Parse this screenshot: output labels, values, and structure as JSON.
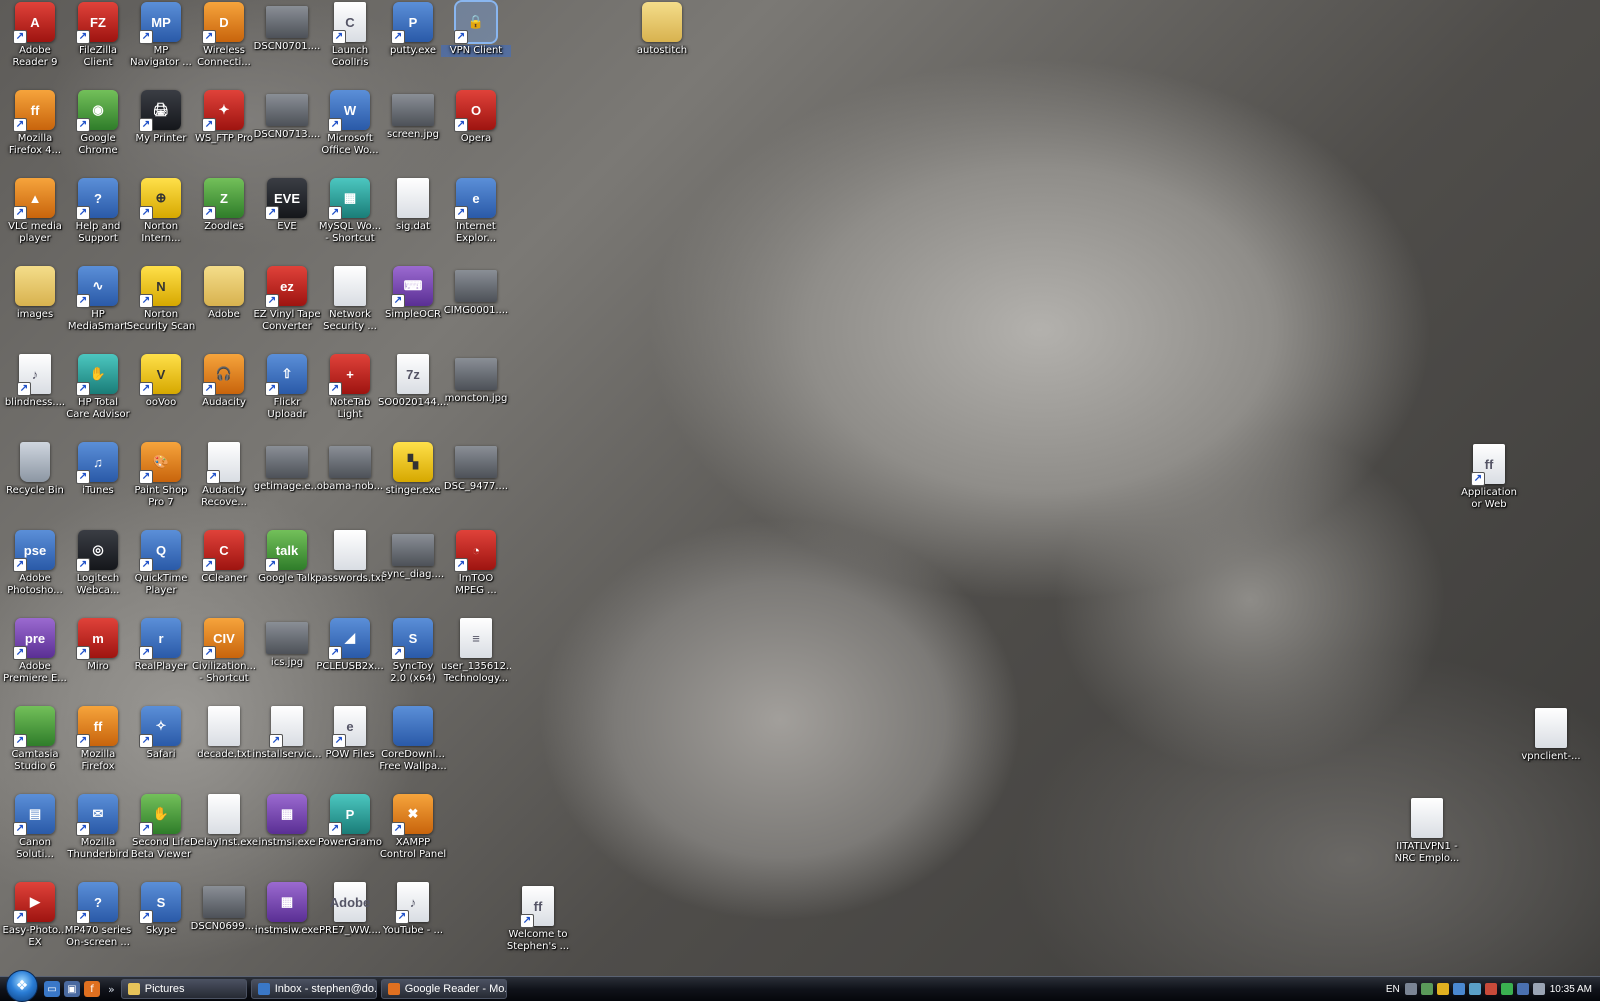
{
  "desktop": {
    "icons": [
      {
        "label": "Adobe\nReader 9",
        "glyph": "A",
        "style": "red",
        "shortcut": true,
        "icon": "adobe-reader-icon"
      },
      {
        "label": "FileZilla\nClient",
        "glyph": "FZ",
        "style": "red",
        "shortcut": true,
        "icon": "filezilla-icon"
      },
      {
        "label": "MP\nNavigator ...",
        "glyph": "MP",
        "style": "app",
        "shortcut": true,
        "icon": "mp-navigator-icon"
      },
      {
        "label": "Wireless\nConnecti...",
        "glyph": "D",
        "style": "orange",
        "shortcut": true,
        "icon": "dlink-wireless-icon"
      },
      {
        "label": "DSCN0701....",
        "glyph": "",
        "style": "photo",
        "shortcut": false,
        "icon": "photo-icon"
      },
      {
        "label": "Launch\nCoolIris",
        "glyph": "C",
        "style": "file",
        "shortcut": true,
        "icon": "cooliris-icon"
      },
      {
        "label": "putty.exe",
        "glyph": "P",
        "style": "app",
        "shortcut": true,
        "icon": "putty-icon"
      },
      {
        "label": "VPN Client",
        "glyph": "🔒",
        "style": "yellow",
        "shortcut": true,
        "icon": "vpn-lock-icon",
        "selected": true
      },
      {
        "label": "autostitch",
        "glyph": "",
        "style": "folder",
        "shortcut": false,
        "icon": "folder-icon"
      },
      {
        "label": "Mozilla\nFirefox 4...",
        "glyph": "ff",
        "style": "orange",
        "shortcut": true,
        "icon": "firefox-icon"
      },
      {
        "label": "Google\nChrome",
        "glyph": "◉",
        "style": "green",
        "shortcut": true,
        "icon": "chrome-icon"
      },
      {
        "label": "My Printer",
        "glyph": "🖨",
        "style": "dark",
        "shortcut": true,
        "icon": "printer-icon"
      },
      {
        "label": "WS_FTP Pro",
        "glyph": "✦",
        "style": "red",
        "shortcut": true,
        "icon": "wsftp-icon"
      },
      {
        "label": "DSCN0713....",
        "glyph": "",
        "style": "photo",
        "shortcut": false,
        "icon": "photo-icon"
      },
      {
        "label": "Microsoft\nOffice Wo...",
        "glyph": "W",
        "style": "app",
        "shortcut": true,
        "icon": "word-icon"
      },
      {
        "label": "screen.jpg",
        "glyph": "",
        "style": "photo",
        "shortcut": false,
        "icon": "image-file-icon"
      },
      {
        "label": "Opera",
        "glyph": "O",
        "style": "red",
        "shortcut": true,
        "icon": "opera-icon"
      },
      {
        "label": "VLC media\nplayer",
        "glyph": "▲",
        "style": "orange",
        "shortcut": true,
        "icon": "vlc-cone-icon"
      },
      {
        "label": "Help and\nSupport",
        "glyph": "?",
        "style": "app",
        "shortcut": true,
        "icon": "help-icon"
      },
      {
        "label": "Norton\nIntern...",
        "glyph": "⊕",
        "style": "yellow",
        "shortcut": true,
        "icon": "norton-globe-icon"
      },
      {
        "label": "Zoodles",
        "glyph": "Z",
        "style": "green",
        "shortcut": true,
        "icon": "zoodles-icon"
      },
      {
        "label": "EVE",
        "glyph": "EVE",
        "style": "dark",
        "shortcut": true,
        "icon": "eve-icon"
      },
      {
        "label": "MySQL Wo...\n- Shortcut",
        "glyph": "▦",
        "style": "teal",
        "shortcut": true,
        "icon": "mysql-icon"
      },
      {
        "label": "sig.dat",
        "glyph": "",
        "style": "file",
        "shortcut": false,
        "icon": "file-icon"
      },
      {
        "label": "Internet\nExplor...",
        "glyph": "e",
        "style": "app",
        "shortcut": true,
        "icon": "ie-icon"
      },
      {
        "label": "images",
        "glyph": "",
        "style": "folder",
        "shortcut": false,
        "icon": "folder-icon"
      },
      {
        "label": "HP\nMediaSmart",
        "glyph": "∿",
        "style": "app",
        "shortcut": true,
        "icon": "hp-mediasmart-icon"
      },
      {
        "label": "Norton\nSecurity Scan",
        "glyph": "N",
        "style": "yellow",
        "shortcut": true,
        "icon": "norton-scan-icon"
      },
      {
        "label": "Adobe",
        "glyph": "",
        "style": "folder",
        "shortcut": false,
        "icon": "folder-icon"
      },
      {
        "label": "EZ Vinyl Tape\nConverter",
        "glyph": "ez",
        "style": "red",
        "shortcut": true,
        "icon": "ez-vinyl-icon"
      },
      {
        "label": "Network\nSecurity ...",
        "glyph": "",
        "style": "file",
        "shortcut": false,
        "icon": "file-icon"
      },
      {
        "label": "SimpleOCR",
        "glyph": "⌨",
        "style": "purple",
        "shortcut": true,
        "icon": "simpleocr-icon"
      },
      {
        "label": "CIMG0001....",
        "glyph": "",
        "style": "photo",
        "shortcut": false,
        "icon": "photo-icon"
      },
      {
        "label": "blindness....",
        "glyph": "♪",
        "style": "file",
        "shortcut": true,
        "icon": "audio-file-icon"
      },
      {
        "label": "HP Total\nCare Advisor",
        "glyph": "✋",
        "style": "teal",
        "shortcut": true,
        "icon": "hp-care-icon"
      },
      {
        "label": "ooVoo",
        "glyph": "V",
        "style": "yellow",
        "shortcut": true,
        "icon": "oovoo-icon"
      },
      {
        "label": "Audacity",
        "glyph": "🎧",
        "style": "orange",
        "shortcut": true,
        "icon": "audacity-icon"
      },
      {
        "label": "Flickr\nUploadr",
        "glyph": "⇧",
        "style": "app",
        "shortcut": true,
        "icon": "flickr-icon"
      },
      {
        "label": "NoteTab\nLight",
        "glyph": "+",
        "style": "red",
        "shortcut": true,
        "icon": "notetab-icon"
      },
      {
        "label": "SO0020144....",
        "glyph": "7z",
        "style": "file",
        "shortcut": false,
        "icon": "archive-icon"
      },
      {
        "label": "moncton.jpg",
        "glyph": "",
        "style": "photo",
        "shortcut": false,
        "icon": "image-file-icon"
      },
      {
        "label": "Recycle Bin",
        "glyph": "",
        "style": "bin",
        "shortcut": false,
        "icon": "recycle-bin-icon"
      },
      {
        "label": "iTunes",
        "glyph": "♫",
        "style": "app",
        "shortcut": true,
        "icon": "itunes-icon"
      },
      {
        "label": "Paint Shop\nPro 7",
        "glyph": "🎨",
        "style": "orange",
        "shortcut": true,
        "icon": "paintshop-icon"
      },
      {
        "label": "Audacity\nRecove...",
        "glyph": "",
        "style": "file",
        "shortcut": true,
        "icon": "file-icon"
      },
      {
        "label": "getimage.e...",
        "glyph": "",
        "style": "photo",
        "shortcut": false,
        "icon": "image-file-icon"
      },
      {
        "label": "obama-nob...",
        "glyph": "",
        "style": "photo",
        "shortcut": false,
        "icon": "image-file-icon"
      },
      {
        "label": "stinger.exe",
        "glyph": "▚",
        "style": "yellow",
        "shortcut": false,
        "icon": "stinger-icon"
      },
      {
        "label": "DSC_9477....",
        "glyph": "",
        "style": "photo",
        "shortcut": false,
        "icon": "photo-icon"
      },
      {
        "label": "Adobe\nPhotosho...",
        "glyph": "pse",
        "style": "app",
        "shortcut": true,
        "icon": "photoshop-elements-icon"
      },
      {
        "label": "Logitech\nWebca...",
        "glyph": "◎",
        "style": "dark",
        "shortcut": true,
        "icon": "webcam-icon"
      },
      {
        "label": "QuickTime\nPlayer",
        "glyph": "Q",
        "style": "app",
        "shortcut": true,
        "icon": "quicktime-icon"
      },
      {
        "label": "CCleaner",
        "glyph": "C",
        "style": "red",
        "shortcut": true,
        "icon": "ccleaner-icon"
      },
      {
        "label": "Google Talk",
        "glyph": "talk",
        "style": "green",
        "shortcut": true,
        "icon": "google-talk-icon"
      },
      {
        "label": "passwords.txt",
        "glyph": "",
        "style": "file",
        "shortcut": false,
        "icon": "text-file-icon"
      },
      {
        "label": "sync_diag....",
        "glyph": "",
        "style": "photo",
        "shortcut": false,
        "icon": "image-file-icon"
      },
      {
        "label": "ImTOO\nMPEG ...",
        "glyph": "◔",
        "style": "red",
        "shortcut": true,
        "icon": "imtoo-icon"
      },
      {
        "label": "Adobe\nPremiere E...",
        "glyph": "pre",
        "style": "purple",
        "shortcut": true,
        "icon": "premiere-icon"
      },
      {
        "label": "Miro",
        "glyph": "m",
        "style": "red",
        "shortcut": true,
        "icon": "miro-icon"
      },
      {
        "label": "RealPlayer",
        "glyph": "r",
        "style": "app",
        "shortcut": true,
        "icon": "realplayer-icon"
      },
      {
        "label": "Civilization...\n- Shortcut",
        "glyph": "CIV",
        "style": "orange",
        "shortcut": true,
        "icon": "civilization-icon"
      },
      {
        "label": "ics.jpg",
        "glyph": "",
        "style": "photo",
        "shortcut": false,
        "icon": "image-file-icon"
      },
      {
        "label": "PCLEUSB2x...",
        "glyph": "◢",
        "style": "app",
        "shortcut": true,
        "icon": "pcle-icon"
      },
      {
        "label": "SyncToy\n2.0 (x64)",
        "glyph": "S",
        "style": "app",
        "shortcut": true,
        "icon": "synctoy-icon"
      },
      {
        "label": "user_135612...\nTechnology...",
        "glyph": "≡",
        "style": "file",
        "shortcut": false,
        "icon": "document-icon"
      },
      {
        "label": "Camtasia\nStudio 6",
        "glyph": "",
        "style": "green",
        "shortcut": true,
        "icon": "camtasia-icon"
      },
      {
        "label": "Mozilla\nFirefox",
        "glyph": "ff",
        "style": "orange",
        "shortcut": true,
        "icon": "firefox-icon"
      },
      {
        "label": "Safari",
        "glyph": "✧",
        "style": "app",
        "shortcut": true,
        "icon": "safari-compass-icon"
      },
      {
        "label": "decade.txt",
        "glyph": "",
        "style": "file",
        "shortcut": false,
        "icon": "text-file-icon"
      },
      {
        "label": "installservic...",
        "glyph": "",
        "style": "file",
        "shortcut": true,
        "icon": "file-icon"
      },
      {
        "label": "POW Files",
        "glyph": "e",
        "style": "file",
        "shortcut": true,
        "icon": "ie-file-icon"
      },
      {
        "label": "CoreDownl...\nFree Wallpa...",
        "glyph": "",
        "style": "app",
        "shortcut": false,
        "icon": "wallpaper-icon"
      },
      {
        "label": "Canon\nSoluti...",
        "glyph": "▤",
        "style": "app",
        "shortcut": true,
        "icon": "canon-icon"
      },
      {
        "label": "Mozilla\nThunderbird",
        "glyph": "✉",
        "style": "app",
        "shortcut": true,
        "icon": "thunderbird-icon"
      },
      {
        "label": "Second Life\nBeta Viewer",
        "glyph": "✋",
        "style": "green",
        "shortcut": true,
        "icon": "second-life-icon"
      },
      {
        "label": "DelayInst.exe",
        "glyph": "",
        "style": "file",
        "shortcut": false,
        "icon": "exe-icon"
      },
      {
        "label": "instmsi.exe",
        "glyph": "▦",
        "style": "purple",
        "shortcut": false,
        "icon": "installer-icon"
      },
      {
        "label": "PowerGramo",
        "glyph": "P",
        "style": "teal",
        "shortcut": true,
        "icon": "powergramo-icon"
      },
      {
        "label": "XAMPP\nControl Panel",
        "glyph": "✖",
        "style": "orange",
        "shortcut": true,
        "icon": "xampp-icon"
      },
      {
        "label": "Easy-Photo...\nEX",
        "glyph": "▶",
        "style": "red",
        "shortcut": true,
        "icon": "easy-photo-icon"
      },
      {
        "label": "MP470 series\nOn-screen ...",
        "glyph": "?",
        "style": "app",
        "shortcut": true,
        "icon": "mp470-help-icon"
      },
      {
        "label": "Skype",
        "glyph": "S",
        "style": "app",
        "shortcut": true,
        "icon": "skype-icon"
      },
      {
        "label": "DSCN0699....",
        "glyph": "",
        "style": "photo",
        "shortcut": false,
        "icon": "photo-icon"
      },
      {
        "label": "instmsiw.exe",
        "glyph": "▦",
        "style": "purple",
        "shortcut": false,
        "icon": "installer-icon"
      },
      {
        "label": "PRE7_WW....",
        "glyph": "Adobe",
        "style": "file",
        "shortcut": false,
        "icon": "adobe-package-icon"
      },
      {
        "label": "YouTube - ...",
        "glyph": "♪",
        "style": "file",
        "shortcut": true,
        "icon": "media-file-icon"
      },
      {
        "label": "Welcome to\nStephen's ...",
        "glyph": "ff",
        "style": "file",
        "shortcut": true,
        "icon": "firefox-doc-icon"
      },
      {
        "label": "Application\nor Web",
        "glyph": "ff",
        "style": "file",
        "shortcut": true,
        "icon": "firefox-doc-icon"
      },
      {
        "label": "vpnclient-...",
        "glyph": "",
        "style": "file",
        "shortcut": false,
        "icon": "vpn-file-icon"
      },
      {
        "label": "IITATLVPN1 -\nNRC Emplo...",
        "glyph": "",
        "style": "file",
        "shortcut": false,
        "icon": "file-icon"
      }
    ]
  },
  "taskbar": {
    "start_icon": "windows-orb-icon",
    "quick_launch": [
      {
        "icon": "show-desktop-icon",
        "color": "#3a78c8",
        "glyph": "▭"
      },
      {
        "icon": "switch-windows-icon",
        "color": "#4a6aa0",
        "glyph": "▣"
      },
      {
        "icon": "firefox-icon",
        "color": "#e07020",
        "glyph": "f"
      }
    ],
    "chevron": "»",
    "tasks": [
      {
        "label": "Pictures",
        "color": "#e6c35a",
        "icon": "folder-icon"
      },
      {
        "label": "Inbox - stephen@do...",
        "color": "#3a78c8",
        "icon": "thunderbird-icon"
      },
      {
        "label": "Google Reader - Mo...",
        "color": "#e07020",
        "icon": "firefox-icon"
      }
    ],
    "tray": {
      "language": "EN",
      "clock": "10:35 AM",
      "icons": [
        {
          "icon": "keyboard-icon",
          "color": "#7a8494"
        },
        {
          "icon": "mail-icon",
          "color": "#5a9a5a"
        },
        {
          "icon": "norton-tray-icon",
          "color": "#e0b020"
        },
        {
          "icon": "network-tray-icon",
          "color": "#4a88d0"
        },
        {
          "icon": "update-tray-icon",
          "color": "#5aa0c8"
        },
        {
          "icon": "security-tray-icon",
          "color": "#c84a3a"
        },
        {
          "icon": "signal-bars-icon",
          "color": "#3ab050"
        },
        {
          "icon": "monitor-tray-icon",
          "color": "#4a70b0"
        },
        {
          "icon": "volume-icon",
          "color": "#9aa4b4"
        }
      ]
    }
  }
}
